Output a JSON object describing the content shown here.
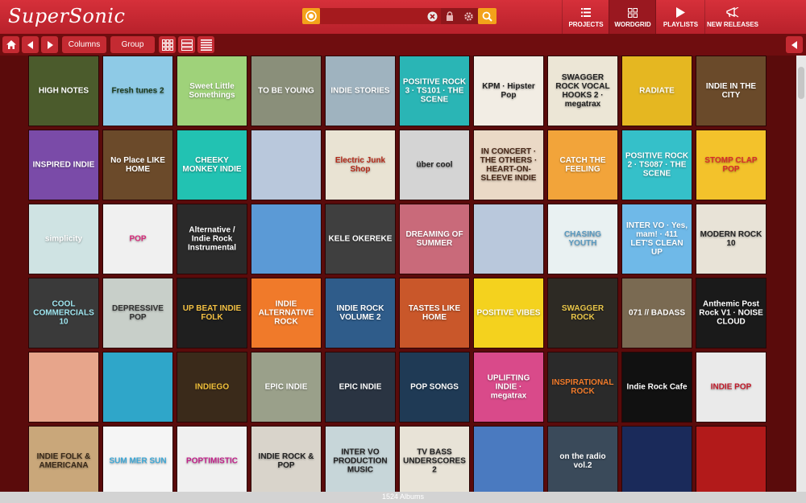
{
  "app": {
    "title": "SuperSonic"
  },
  "search": {
    "value": "",
    "placeholder": ""
  },
  "nav": [
    {
      "label": "PROJECTS",
      "icon": "list-icon"
    },
    {
      "label": "WORDGRID",
      "icon": "grid-icon"
    },
    {
      "label": "PLAYLISTS",
      "icon": "play-icon"
    },
    {
      "label": "NEW RELEASES",
      "icon": "megaphone-icon"
    }
  ],
  "toolbar": {
    "columns_label": "Columns",
    "group_label": "Group"
  },
  "status": {
    "count_text": "1524 Albums"
  },
  "albums": [
    {
      "title": "HIGH NOTES",
      "bg": "#4b5b2c",
      "fg": "#ffffff"
    },
    {
      "title": "Fresh tunes 2",
      "bg": "#8ecae6",
      "fg": "#1b3a1b"
    },
    {
      "title": "Sweet Little Somethings",
      "bg": "#9fd27a",
      "fg": "#ffffff"
    },
    {
      "title": "TO BE YOUNG",
      "bg": "#8a8f7a",
      "fg": "#ffffff"
    },
    {
      "title": "INDIE STORIES",
      "bg": "#9fb3bf",
      "fg": "#ffffff"
    },
    {
      "title": "POSITIVE ROCK 3 · TS101 · THE SCENE",
      "bg": "#2ab5b5",
      "fg": "#ffffff"
    },
    {
      "title": "KPM · Hipster Pop",
      "bg": "#f2ede4",
      "fg": "#222222"
    },
    {
      "title": "SWAGGER ROCK VOCAL HOOKS 2 · megatrax",
      "bg": "#ece6d6",
      "fg": "#222222"
    },
    {
      "title": "RADIATE",
      "bg": "#e5b721",
      "fg": "#ffffff"
    },
    {
      "title": "INDIE IN THE CITY",
      "bg": "#6a4a2a",
      "fg": "#ffffff"
    },
    {
      "title": "INSPIRED INDIE",
      "bg": "#7a4ba8",
      "fg": "#ffffff"
    },
    {
      "title": "No Place LIKE HOME",
      "bg": "#6b4a2a",
      "fg": "#ffffff"
    },
    {
      "title": "CHEEKY MONKEY INDIE",
      "bg": "#22c2b2",
      "fg": "#ffffff"
    },
    {
      "title": "",
      "bg": "#b9c8dc",
      "fg": "#ffffff"
    },
    {
      "title": "Electric Junk Shop",
      "bg": "#e9e3d3",
      "fg": "#b42a1a"
    },
    {
      "title": "über cool",
      "bg": "#d4d4d4",
      "fg": "#222222"
    },
    {
      "title": "IN CONCERT · THE OTHERS · HEART-ON-SLEEVE INDIE",
      "bg": "#ead9c6",
      "fg": "#4a2a1a"
    },
    {
      "title": "CATCH THE FEELING",
      "bg": "#f2a43a",
      "fg": "#ffffff"
    },
    {
      "title": "POSITIVE ROCK 2 · TS087 · THE SCENE",
      "bg": "#35c0c9",
      "fg": "#ffffff"
    },
    {
      "title": "STOMP CLAP POP",
      "bg": "#f3c22b",
      "fg": "#d92b2b"
    },
    {
      "title": "simplicity",
      "bg": "#cfe3e3",
      "fg": "#ffffff"
    },
    {
      "title": "POP",
      "bg": "#f0f0f0",
      "fg": "#d62a7a"
    },
    {
      "title": "Alternative / Indie Rock Instrumental",
      "bg": "#2a2a2a",
      "fg": "#ffffff"
    },
    {
      "title": "",
      "bg": "#5b9ad6",
      "fg": "#ffffff"
    },
    {
      "title": "KELE OKEREKE",
      "bg": "#3f3f3f",
      "fg": "#ffffff"
    },
    {
      "title": "DREAMING OF SUMMER",
      "bg": "#c96a7a",
      "fg": "#ffffff"
    },
    {
      "title": "",
      "bg": "#b9c8dc",
      "fg": "#ffffff"
    },
    {
      "title": "CHASING YOUTH",
      "bg": "#e9f1f2",
      "fg": "#5a9ac0"
    },
    {
      "title": "INTER VO · Yes, mam! · 411 LET'S CLEAN UP",
      "bg": "#6fb9e8",
      "fg": "#ffffff"
    },
    {
      "title": "MODERN ROCK 10",
      "bg": "#e8e3d7",
      "fg": "#222222"
    },
    {
      "title": "COOL COMMERCIALS 10",
      "bg": "#3a3a3a",
      "fg": "#9fe6f0"
    },
    {
      "title": "DEPRESSIVE POP",
      "bg": "#c8cfc9",
      "fg": "#333333"
    },
    {
      "title": "UP BEAT INDIE FOLK",
      "bg": "#1f1f1f",
      "fg": "#f5c244"
    },
    {
      "title": "INDIE ALTERNATIVE ROCK",
      "bg": "#f07a2a",
      "fg": "#ffffff"
    },
    {
      "title": "INDIE ROCK VOLUME 2",
      "bg": "#2f5c8a",
      "fg": "#ffffff"
    },
    {
      "title": "TASTES LIKE HOME",
      "bg": "#c9572a",
      "fg": "#ffffff"
    },
    {
      "title": "POSITIVE VIBES",
      "bg": "#f4d21e",
      "fg": "#ffffff"
    },
    {
      "title": "SWAGGER ROCK",
      "bg": "#2d2a24",
      "fg": "#e9c64a"
    },
    {
      "title": "071 // BADASS",
      "bg": "#7a6a52",
      "fg": "#ffffff"
    },
    {
      "title": "Anthemic Post Rock V1 · NOISE CLOUD",
      "bg": "#1a1a1a",
      "fg": "#ffffff"
    },
    {
      "title": "",
      "bg": "#e7a58b",
      "fg": "#ffffff"
    },
    {
      "title": "",
      "bg": "#2fa6c9",
      "fg": "#ffffff"
    },
    {
      "title": "INDIEGO",
      "bg": "#3a2a1a",
      "fg": "#f2c13a"
    },
    {
      "title": "EPIC INDIE",
      "bg": "#9aa08a",
      "fg": "#ffffff"
    },
    {
      "title": "EPIC INDIE",
      "bg": "#2a3442",
      "fg": "#ffffff"
    },
    {
      "title": "POP SONGS",
      "bg": "#1f3a55",
      "fg": "#ffffff"
    },
    {
      "title": "UPLIFTING INDIE · megatrax",
      "bg": "#d94a8a",
      "fg": "#ffffff"
    },
    {
      "title": "INSPIRATIONAL ROCK",
      "bg": "#2a2a2a",
      "fg": "#f07a2a"
    },
    {
      "title": "Indie Rock Cafe",
      "bg": "#111111",
      "fg": "#ffffff"
    },
    {
      "title": "INDIE POP",
      "bg": "#eaeaea",
      "fg": "#c21a2a"
    },
    {
      "title": "INDIE FOLK & AMERICANA",
      "bg": "#c9a77a",
      "fg": "#3a2a1a"
    },
    {
      "title": "SUM MER SUN",
      "bg": "#f5f5f5",
      "fg": "#3aa6d6"
    },
    {
      "title": "POPTIMISTIC",
      "bg": "#f0f0f0",
      "fg": "#c2208a"
    },
    {
      "title": "INDIE ROCK & POP",
      "bg": "#d9d4cb",
      "fg": "#222222"
    },
    {
      "title": "INTER VO PRODUCTION MUSIC",
      "bg": "#c7d6d9",
      "fg": "#222222"
    },
    {
      "title": "TV BASS UNDERSCORES 2",
      "bg": "#e8e3d7",
      "fg": "#222222"
    },
    {
      "title": "",
      "bg": "#4a7ac0",
      "fg": "#ffffff"
    },
    {
      "title": "on the radio vol.2",
      "bg": "#3a4a5a",
      "fg": "#ffffff"
    },
    {
      "title": "",
      "bg": "#1a2a5a",
      "fg": "#ffffff"
    },
    {
      "title": "",
      "bg": "#b21a1a",
      "fg": "#ffffff"
    }
  ]
}
